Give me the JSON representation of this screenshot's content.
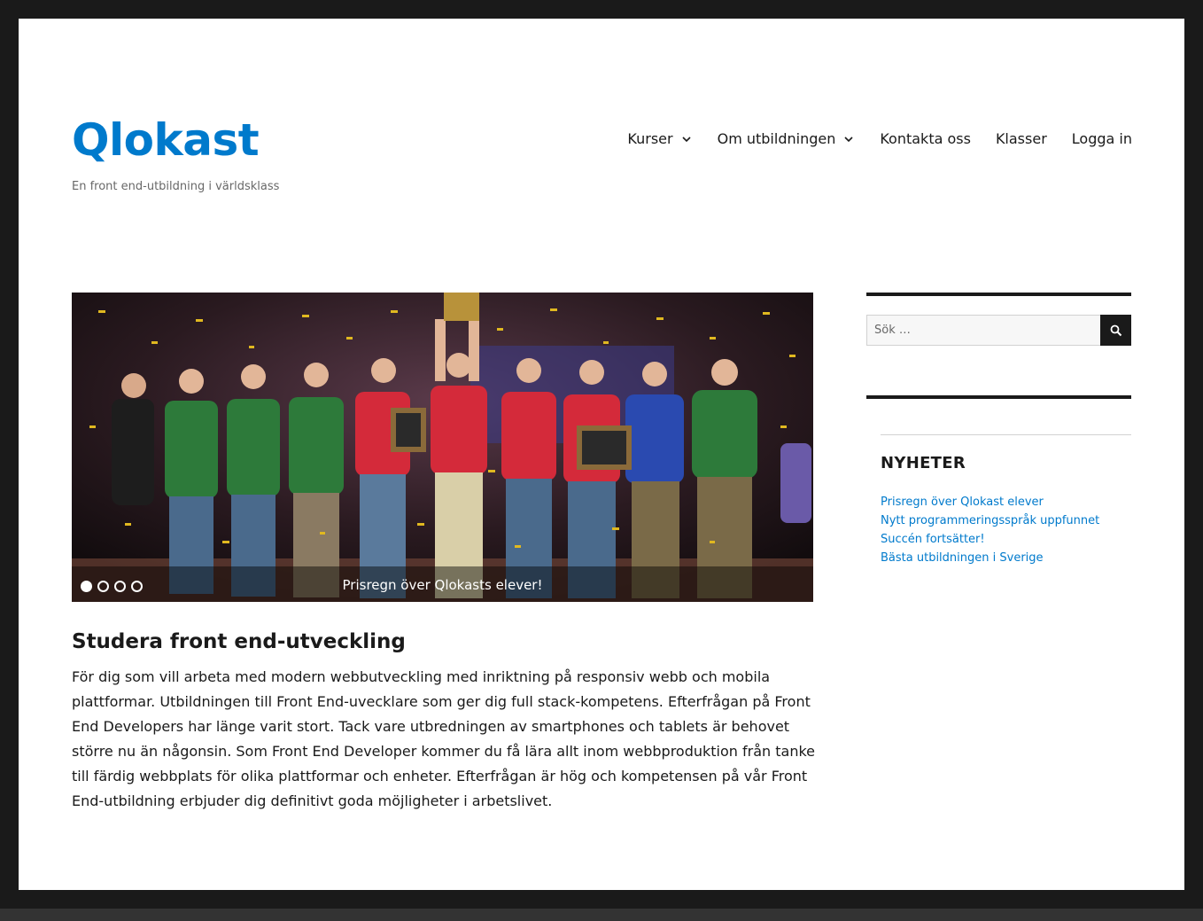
{
  "site": {
    "title": "Qlokast",
    "description": "En front end-utbildning i världsklass"
  },
  "nav": {
    "items": [
      {
        "label": "Kurser",
        "has_submenu": true
      },
      {
        "label": "Om utbildningen",
        "has_submenu": true
      },
      {
        "label": "Kontakta oss",
        "has_submenu": false
      },
      {
        "label": "Klasser",
        "has_submenu": false
      },
      {
        "label": "Logga in",
        "has_submenu": false
      }
    ]
  },
  "slider": {
    "caption": "Prisregn över Qlokasts elever!",
    "slide_count": 4,
    "active_slide": 1
  },
  "article": {
    "title": "Studera front end-utveckling",
    "body": "För dig som vill arbeta med modern webbutveckling med inriktning på responsiv webb och mobila plattformar. Utbildningen till Front End-uvecklare som ger dig full stack-kompetens. Efterfrågan på Front End Developers har länge varit stort. Tack vare utbredningen av smartphones och tablets är behovet större nu än någonsin. Som Front End Developer kommer du få lära allt inom webbproduktion från tanke till färdig webbplats för olika plattformar och enheter. Efterfrågan är hög och kompetensen på vår Front End-utbildning erbjuder dig definitivt goda möjligheter i arbetslivet."
  },
  "sidebar": {
    "search": {
      "placeholder": "Sök …",
      "value": "",
      "button_icon": "search-icon"
    },
    "news": {
      "title": "NYHETER",
      "items": [
        "Prisregn över Qlokast elever",
        "Nytt programmeringsspråk uppfunnet",
        "Succén fortsätter!",
        "Bästa utbildningen i Sverige"
      ]
    }
  },
  "colors": {
    "accent": "#007acc",
    "text": "#1a1a1a",
    "frame": "#1a1a1a",
    "muted": "#686868"
  }
}
